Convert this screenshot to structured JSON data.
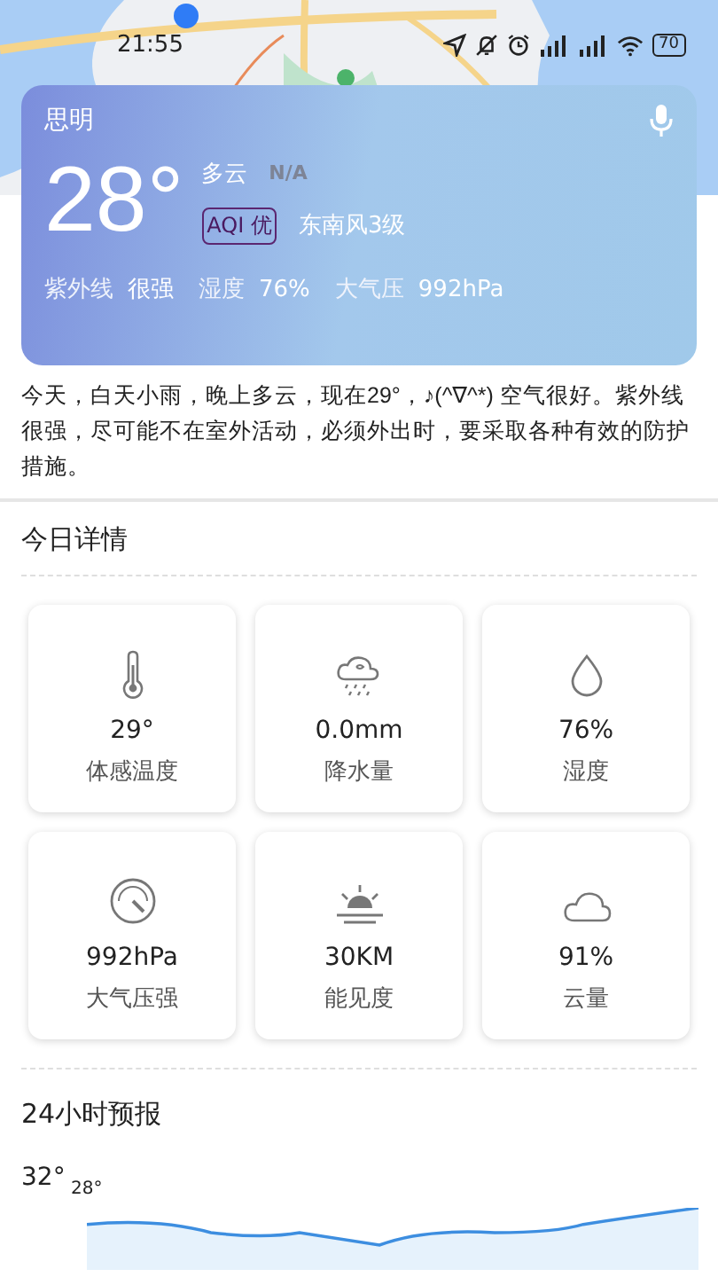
{
  "status_bar": {
    "time": "21:55",
    "battery": "70"
  },
  "weather": {
    "location": "思明",
    "temperature": "28°",
    "condition": "多云",
    "quality": "N/A",
    "aqi_badge": "AQI 优",
    "wind": "东南风3级",
    "stats": [
      {
        "label": "紫外线",
        "value": "很强"
      },
      {
        "label": "湿度",
        "value": "76%"
      },
      {
        "label": "大气压",
        "value": "992hPa"
      }
    ]
  },
  "summary": "今天，白天小雨，晚上多云，现在29°，♪(^∇^*) 空气很好。紫外线很强，尽可能不在室外活动，必须外出时，要采取各种有效的防护措施。",
  "details": {
    "title": "今日详情",
    "items": [
      {
        "kind": "thermometer",
        "value": "29°",
        "label": "体感温度"
      },
      {
        "kind": "rain",
        "value": "0.0mm",
        "label": "降水量"
      },
      {
        "kind": "drop",
        "value": "76%",
        "label": "湿度"
      },
      {
        "kind": "gauge",
        "value": "992hPa",
        "label": "大气压强"
      },
      {
        "kind": "horizon",
        "value": "30KM",
        "label": "能见度"
      },
      {
        "kind": "cloud",
        "value": "91%",
        "label": "云量"
      }
    ]
  },
  "forecast": {
    "title": "24小时预报",
    "high": "32°",
    "first_temp": "28°"
  }
}
